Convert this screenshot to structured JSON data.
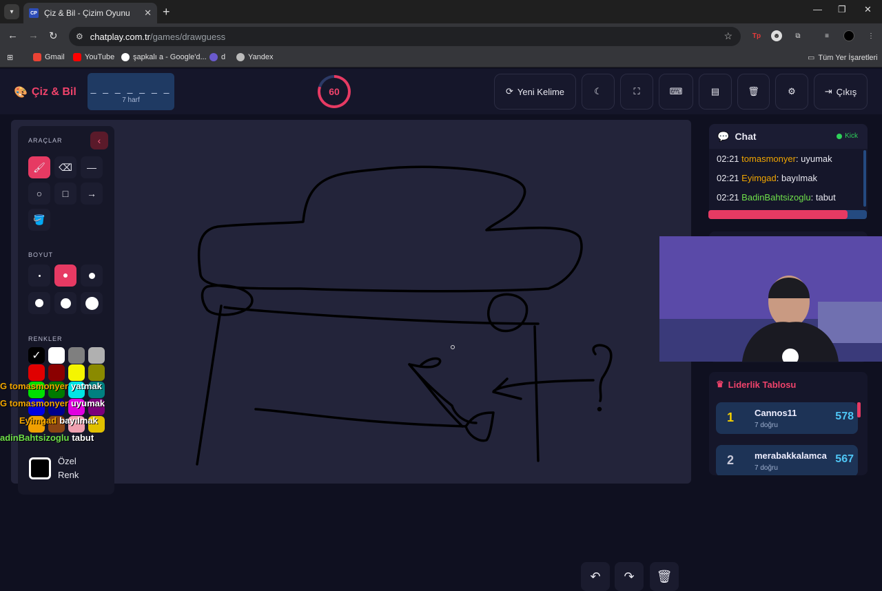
{
  "browser": {
    "tab_favicon": "CP",
    "tab_title": "Çiz & Bil - Çizim Oyunu",
    "url_host": "chatplay.com.tr",
    "url_path": "/games/drawguess",
    "bookmarks": [
      "Gmail",
      "YouTube",
      "şapkalı a - Google'd...",
      "d",
      "Yandex"
    ],
    "all_bookmarks": "Tüm Yer İşaretleri"
  },
  "header": {
    "logo": "Çiz & Bil",
    "word_blanks": "_ _ _ _ _ _ _",
    "word_hint": "7 harf",
    "timer": "60",
    "timer_fraction": 0.8,
    "new_word": "Yeni Kelime",
    "exit": "Çıkış"
  },
  "tools": {
    "title": "ARAÇLAR",
    "size_title": "BOYUT",
    "colors_title": "RENKLER",
    "custom_color": "Özel Renk",
    "colors": [
      "#000000",
      "#ffffff",
      "#7f7f7f",
      "#b0b0b0",
      "#e00000",
      "#8b0000",
      "#f5f500",
      "#8a8a00",
      "#00e000",
      "#007a00",
      "#00e5e5",
      "#008080",
      "#0000e0",
      "#00008b",
      "#e000e0",
      "#7a007a",
      "#f0a000",
      "#8b4513",
      "#f0a0b0",
      "#e0c000"
    ]
  },
  "overlay_messages": [
    {
      "user": "G tomasmonyer",
      "text": "yatmak"
    },
    {
      "user": "G tomasmonyer",
      "text": "uyumak"
    },
    {
      "user": "Eyimgad",
      "text": "bayılmak"
    },
    {
      "user": "adinBahtsizoglu",
      "text": "tabut"
    }
  ],
  "chat": {
    "title": "Chat",
    "status": "Kick",
    "messages": [
      {
        "time": "02:21",
        "user": "tomasmonyer",
        "color": "#f0a500",
        "text": ": uyumak"
      },
      {
        "time": "02:21",
        "user": "Eyimgad",
        "color": "#f0a500",
        "text": ": bayılmak"
      },
      {
        "time": "02:21",
        "user": "BadinBahtsizoglu",
        "color": "#6fe04a",
        "text": ": tabut"
      }
    ],
    "progress": 0.88
  },
  "leaderboard": {
    "title": "Liderlik Tablosu",
    "rows": [
      {
        "rank": "1",
        "name": "Cannos11",
        "sub": "7 doğru",
        "score": "578",
        "rank_color": "#f5d000"
      },
      {
        "rank": "2",
        "name": "merabakkalamca",
        "sub": "7 doğru",
        "score": "567",
        "rank_color": "#c8c8d8"
      }
    ]
  }
}
